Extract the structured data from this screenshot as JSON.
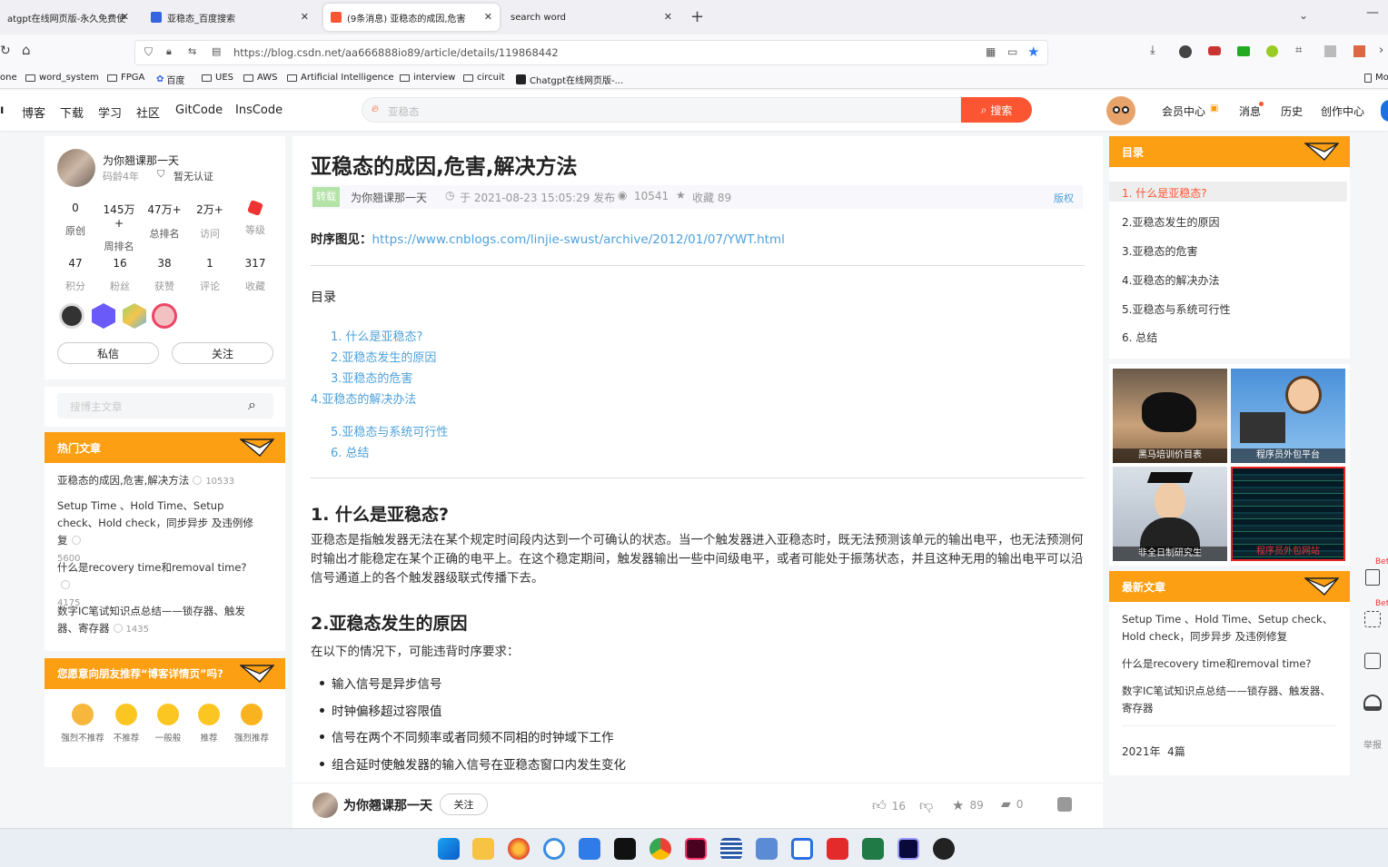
{
  "browser": {
    "tabs": [
      {
        "title": "atgpt在线网页版-永久免费使"
      },
      {
        "title": "亚稳态_百度搜索"
      },
      {
        "title": "(9条消息) 亚稳态的成因,危害,解决方法"
      },
      {
        "title": "search word"
      }
    ],
    "url": "https://blog.csdn.net/aa666888io89/article/details/119868442",
    "bookmarks": [
      "one",
      "word_system",
      "FPGA",
      "百度",
      "UES",
      "AWS",
      "Artificial Intelligence",
      "interview",
      "circuit",
      "Chatgpt在线网页版-...",
      "Mo"
    ]
  },
  "header": {
    "nav": [
      "博客",
      "下载",
      "学习",
      "社区",
      "GitCode",
      "InsCode"
    ],
    "search_placeholder": "亚稳态",
    "search_button": "搜索",
    "right": [
      "会员中心",
      "消息",
      "历史",
      "创作中心"
    ]
  },
  "profile": {
    "name": "为你翘课那一天",
    "age": "码龄4年",
    "cert": "暂无认证",
    "stats_row1": [
      {
        "value": "0",
        "label": "原创"
      },
      {
        "value": "145万+",
        "label": "周排名"
      },
      {
        "value": "47万+",
        "label": "总排名"
      },
      {
        "value": "2万+",
        "label": "访问"
      },
      {
        "value": "",
        "label": "等级"
      }
    ],
    "stats_row2": [
      {
        "value": "47",
        "label": "积分"
      },
      {
        "value": "16",
        "label": "粉丝"
      },
      {
        "value": "38",
        "label": "获赞"
      },
      {
        "value": "1",
        "label": "评论"
      },
      {
        "value": "317",
        "label": "收藏"
      }
    ],
    "message_btn": "私信",
    "follow_btn": "关注"
  },
  "search_author": {
    "placeholder": "搜博主文章"
  },
  "hot": {
    "title": "热门文章",
    "items": [
      {
        "title": "亚稳态的成因,危害,解决方法",
        "views": "10533"
      },
      {
        "title": "Setup Time 、Hold Time、Setup check、Hold check，同步异步 及违例修复",
        "views": "5600"
      },
      {
        "title": "什么是recovery time和removal time?",
        "views": "4175"
      },
      {
        "title": "数字IC笔试知识点总结——锁存器、触发器、寄存器",
        "views": "1435"
      }
    ]
  },
  "recommend": {
    "title": "您愿意向朋友推荐“博客详情页”吗?",
    "options": [
      "强烈不推荐",
      "不推荐",
      "一般般",
      "推荐",
      "强烈推荐"
    ]
  },
  "article": {
    "title": "亚稳态的成因,危害,解决方法",
    "tag": "转载",
    "author": "为你翘课那一天",
    "date": "于 2021-08-23 15:05:29 发布",
    "views": "10541",
    "favorites": "收藏 89",
    "copyright": "版权",
    "ref_label": "时序图见：",
    "ref_link": "https://www.cnblogs.com/linjie-swust/archive/2012/01/07/YWT.html",
    "toc_title": "目录",
    "toc": [
      "1. 什么是亚稳态?",
      "2.亚稳态发生的原因",
      "3.亚稳态的危害",
      "4.亚稳态的解决办法",
      "5.亚稳态与系统可行性",
      "6. 总结"
    ],
    "h1": "1. 什么是亚稳态?",
    "p1": "亚稳态是指触发器无法在某个规定时间段内达到一个可确认的状态。当一个触发器进入亚稳态时，既无法预测该单元的输出电平，也无法预测何时输出才能稳定在某个正确的电平上。在这个稳定期间，触发器输出一些中间级电平，或者可能处于振荡状态，并且这种无用的输出电平可以沿信号通道上的各个触发器级联式传播下去。",
    "h2": "2.亚稳态发生的原因",
    "p2": "在以下的情况下，可能违背时序要求：",
    "bullets": [
      "输入信号是异步信号",
      "时钟偏移超过容限值",
      "信号在两个不同频率或者同频不同相的时钟域下工作",
      "组合延时使触发器的输入信号在亚稳态窗口内发生变化"
    ]
  },
  "bottom": {
    "author": "为你翘课那一天",
    "follow": "关注",
    "likes": "16",
    "favorites": "89",
    "comments": "0"
  },
  "right_toc": {
    "title": "目录",
    "items": [
      "1. 什么是亚稳态?",
      "2.亚稳态发生的原因",
      "3.亚稳态的危害",
      "4.亚稳态的解决办法",
      "5.亚稳态与系统可行性",
      "6. 总结"
    ]
  },
  "ads": [
    {
      "caption": "黑马培训价目表"
    },
    {
      "caption": "程序员外包平台"
    },
    {
      "caption": "非全日制研究生"
    },
    {
      "caption": "程序员外包网站"
    }
  ],
  "latest": {
    "title": "最新文章",
    "items": [
      "Setup Time 、Hold Time、Setup check、Hold check，同步异步 及违例修复",
      "什么是recovery time和removal time?",
      "数字IC笔试知识点总结——锁存器、触发器、寄存器"
    ],
    "archive": "2021年  4篇"
  },
  "side_tools": {
    "report": "举报",
    "beta": "Beta"
  },
  "colors": {
    "accent": "#fc9f12",
    "link": "#4ea1db",
    "csdn_red": "#fc5531"
  }
}
